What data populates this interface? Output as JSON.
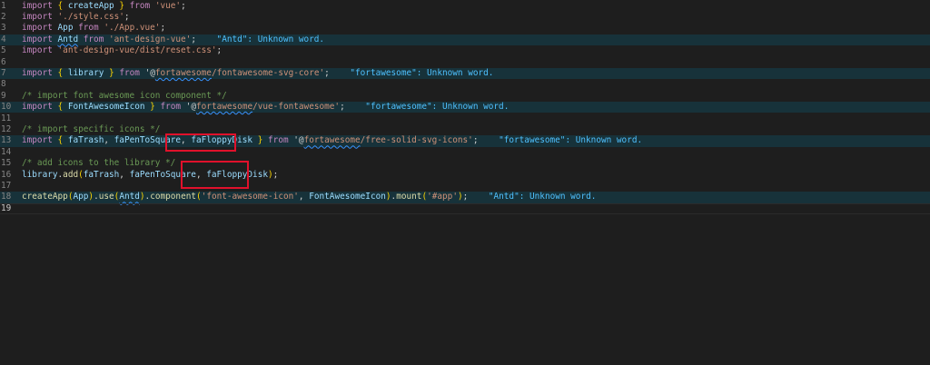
{
  "editor": {
    "lines": [
      {
        "num": "1",
        "parts": [
          {
            "t": "import",
            "c": "kw"
          },
          {
            "t": " "
          },
          {
            "t": "{",
            "c": "brace"
          },
          {
            "t": " "
          },
          {
            "t": "createApp",
            "c": "id"
          },
          {
            "t": " "
          },
          {
            "t": "}",
            "c": "brace"
          },
          {
            "t": " "
          },
          {
            "t": "from",
            "c": "kw"
          },
          {
            "t": " "
          },
          {
            "t": "'vue'",
            "c": "str"
          },
          {
            "t": ";"
          }
        ]
      },
      {
        "num": "2",
        "parts": [
          {
            "t": "import",
            "c": "kw"
          },
          {
            "t": " "
          },
          {
            "t": "'./style.css'",
            "c": "str"
          },
          {
            "t": ";"
          }
        ]
      },
      {
        "num": "3",
        "parts": [
          {
            "t": "import",
            "c": "kw"
          },
          {
            "t": " "
          },
          {
            "t": "App",
            "c": "id"
          },
          {
            "t": " "
          },
          {
            "t": "from",
            "c": "kw"
          },
          {
            "t": " "
          },
          {
            "t": "'./App.vue'",
            "c": "str"
          },
          {
            "t": ";"
          }
        ]
      },
      {
        "num": "4",
        "hl": true,
        "parts": [
          {
            "t": "import",
            "c": "kw"
          },
          {
            "t": " "
          },
          {
            "t": "Antd",
            "c": "id sq"
          },
          {
            "t": " "
          },
          {
            "t": "from",
            "c": "kw"
          },
          {
            "t": " "
          },
          {
            "t": "'ant-design-vue'",
            "c": "str"
          },
          {
            "t": ";"
          },
          {
            "t": "    "
          },
          {
            "t": "\"Antd\": Unknown word.",
            "c": "diag"
          }
        ]
      },
      {
        "num": "5",
        "parts": [
          {
            "t": "import",
            "c": "kw"
          },
          {
            "t": " "
          },
          {
            "t": "'ant-design-vue/dist/reset.css'",
            "c": "str"
          },
          {
            "t": ";"
          }
        ]
      },
      {
        "num": "6",
        "parts": []
      },
      {
        "num": "7",
        "hl": true,
        "parts": [
          {
            "t": "import",
            "c": "kw"
          },
          {
            "t": " "
          },
          {
            "t": "{",
            "c": "brace"
          },
          {
            "t": " "
          },
          {
            "t": "library",
            "c": "id"
          },
          {
            "t": " "
          },
          {
            "t": "}",
            "c": "brace"
          },
          {
            "t": " "
          },
          {
            "t": "from",
            "c": "kw"
          },
          {
            "t": " "
          },
          {
            "t": "'@"
          },
          {
            "t": "fortawesome",
            "c": "str sq"
          },
          {
            "t": "/fontawesome-svg-core'",
            "c": "str"
          },
          {
            "t": ";"
          },
          {
            "t": "    "
          },
          {
            "t": "\"fortawesome\": Unknown word.",
            "c": "diag"
          }
        ]
      },
      {
        "num": "8",
        "parts": []
      },
      {
        "num": "9",
        "parts": [
          {
            "t": "/* import font awesome icon component */",
            "c": "cmt"
          }
        ]
      },
      {
        "num": "10",
        "hl": true,
        "parts": [
          {
            "t": "import",
            "c": "kw"
          },
          {
            "t": " "
          },
          {
            "t": "{",
            "c": "brace"
          },
          {
            "t": " "
          },
          {
            "t": "FontAwesomeIcon",
            "c": "id"
          },
          {
            "t": " "
          },
          {
            "t": "}",
            "c": "brace"
          },
          {
            "t": " "
          },
          {
            "t": "from",
            "c": "kw"
          },
          {
            "t": " "
          },
          {
            "t": "'@"
          },
          {
            "t": "fortawesome",
            "c": "str sq"
          },
          {
            "t": "/vue-fontawesome'",
            "c": "str"
          },
          {
            "t": ";"
          },
          {
            "t": "    "
          },
          {
            "t": "\"fortawesome\": Unknown word.",
            "c": "diag"
          }
        ]
      },
      {
        "num": "11",
        "parts": []
      },
      {
        "num": "12",
        "parts": [
          {
            "t": "/* import specific icons */",
            "c": "cmt"
          }
        ]
      },
      {
        "num": "13",
        "hl": true,
        "parts": [
          {
            "t": "import",
            "c": "kw"
          },
          {
            "t": " "
          },
          {
            "t": "{",
            "c": "brace"
          },
          {
            "t": " "
          },
          {
            "t": "faTrash",
            "c": "id"
          },
          {
            "t": ", "
          },
          {
            "t": "faPenToSquare",
            "c": "id"
          },
          {
            "t": ", "
          },
          {
            "t": "faFloppyDisk",
            "c": "id"
          },
          {
            "t": " "
          },
          {
            "t": "}",
            "c": "brace"
          },
          {
            "t": " "
          },
          {
            "t": "from",
            "c": "kw"
          },
          {
            "t": " "
          },
          {
            "t": "'@"
          },
          {
            "t": "fortawesome",
            "c": "str sq"
          },
          {
            "t": "/free-solid-svg-icons'",
            "c": "str"
          },
          {
            "t": ";"
          },
          {
            "t": "    "
          },
          {
            "t": "\"fortawesome\": Unknown word.",
            "c": "diag"
          }
        ]
      },
      {
        "num": "14",
        "parts": []
      },
      {
        "num": "15",
        "parts": [
          {
            "t": "/* add icons to the library */",
            "c": "cmt"
          }
        ]
      },
      {
        "num": "16",
        "parts": [
          {
            "t": "library",
            "c": "id"
          },
          {
            "t": "."
          },
          {
            "t": "add",
            "c": "fn"
          },
          {
            "t": "(",
            "c": "brace"
          },
          {
            "t": "faTrash",
            "c": "id"
          },
          {
            "t": ", "
          },
          {
            "t": "faPenToSquare",
            "c": "id"
          },
          {
            "t": ", "
          },
          {
            "t": "faFloppyDisk",
            "c": "id"
          },
          {
            "t": ")",
            "c": "brace"
          },
          {
            "t": ";"
          }
        ]
      },
      {
        "num": "17",
        "parts": []
      },
      {
        "num": "18",
        "hl": true,
        "parts": [
          {
            "t": "createApp",
            "c": "fn"
          },
          {
            "t": "(",
            "c": "brace"
          },
          {
            "t": "App",
            "c": "id"
          },
          {
            "t": ")",
            "c": "brace"
          },
          {
            "t": "."
          },
          {
            "t": "use",
            "c": "fn"
          },
          {
            "t": "(",
            "c": "brace"
          },
          {
            "t": "Antd",
            "c": "id sq"
          },
          {
            "t": ")",
            "c": "brace"
          },
          {
            "t": "."
          },
          {
            "t": "component",
            "c": "fn"
          },
          {
            "t": "(",
            "c": "brace"
          },
          {
            "t": "'font-awesome-icon'",
            "c": "str"
          },
          {
            "t": ", "
          },
          {
            "t": "FontAwesomeIcon",
            "c": "id"
          },
          {
            "t": ")",
            "c": "brace"
          },
          {
            "t": "."
          },
          {
            "t": "mount",
            "c": "fn"
          },
          {
            "t": "(",
            "c": "brace"
          },
          {
            "t": "'#app'",
            "c": "str"
          },
          {
            "t": ")",
            "c": "brace"
          },
          {
            "t": ";"
          },
          {
            "t": "    "
          },
          {
            "t": "\"Antd\": Unknown word.",
            "c": "diag"
          }
        ]
      },
      {
        "num": "19",
        "current": true,
        "parts": []
      }
    ]
  },
  "colors": {
    "background": "#1e1e1e",
    "diagnostic_highlight": "#17323a",
    "callout_border": "#e0112b"
  }
}
